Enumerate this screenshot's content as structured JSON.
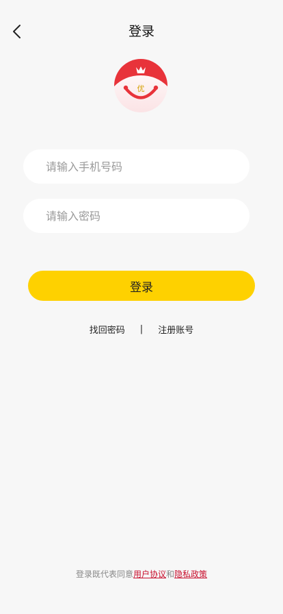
{
  "nav": {
    "title": "登录"
  },
  "logo": {
    "badge_text": "优"
  },
  "form": {
    "phone_placeholder": "请输入手机号码",
    "password_placeholder": "请输入密码",
    "submit_label": "登录"
  },
  "links": {
    "forgot_password": "找回密码",
    "separator": "|",
    "register": "注册账号"
  },
  "agreement": {
    "prefix": "登录既代表同意",
    "user_agreement": "用户协议",
    "conjunction": "和",
    "privacy_policy": "隐私政策"
  },
  "colors": {
    "background": "#f7f7f7",
    "accent_yellow": "#fed100",
    "logo_red": "#e8333a",
    "link_red": "#c8102e"
  }
}
